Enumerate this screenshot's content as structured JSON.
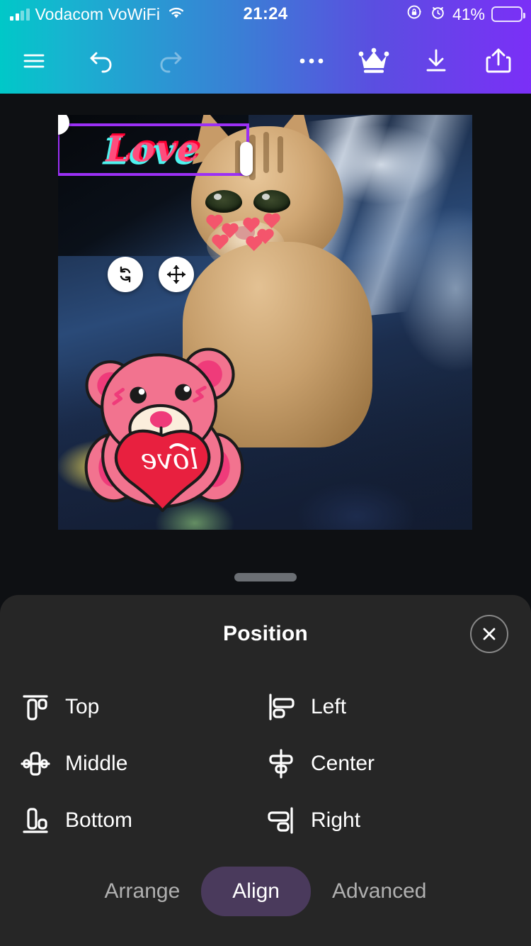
{
  "status_bar": {
    "carrier": "Vodacom VoWiFi",
    "time": "21:24",
    "battery_percent": "41%",
    "icons": [
      "signal-bars-icon",
      "wifi-icon",
      "rotation-lock-icon",
      "alarm-clock-icon",
      "battery-icon"
    ],
    "battery_fill_color": "#ffcc00",
    "battery_level": 41
  },
  "toolbar": {
    "gradient_start": "#00c8c8",
    "gradient_mid": "#3a7fd5",
    "gradient_end": "#7b2ff7",
    "buttons": [
      {
        "name": "menu-button",
        "icon": "hamburger-menu-icon",
        "enabled": true
      },
      {
        "name": "undo-button",
        "icon": "undo-arrow-icon",
        "enabled": true
      },
      {
        "name": "redo-button",
        "icon": "redo-arrow-icon",
        "enabled": false
      },
      {
        "name": "more-options-button",
        "icon": "ellipsis-icon",
        "enabled": true
      },
      {
        "name": "premium-button",
        "icon": "crown-icon",
        "enabled": true
      },
      {
        "name": "download-button",
        "icon": "download-arrow-icon",
        "enabled": true
      },
      {
        "name": "share-button",
        "icon": "share-upload-icon",
        "enabled": true
      }
    ]
  },
  "canvas": {
    "background_color": "#0e1013",
    "photo_description": "orange tabby cat on blue and white bedding",
    "text_layer": {
      "text": "Love",
      "selected": true,
      "selection_color": "#9b30f5",
      "fill_color": "#ff4d7d",
      "shadow_color": "#4ff3ef"
    },
    "sticker_bear": {
      "name": "teddy-bear-sticker",
      "heart_text": "love",
      "bear_color": "#f2738f",
      "heart_color": "#e8203f"
    },
    "floating_buttons": [
      {
        "name": "rotate-button",
        "icon": "rotate-icon"
      },
      {
        "name": "move-button",
        "icon": "move-arrows-icon"
      }
    ]
  },
  "panel": {
    "title": "Position",
    "close_icon": "close-x-icon",
    "drag_handle": "panel-drag-handle",
    "align_options": [
      {
        "label": "Top",
        "icon": "align-top-icon",
        "column": "left"
      },
      {
        "label": "Left",
        "icon": "align-left-icon",
        "column": "right"
      },
      {
        "label": "Middle",
        "icon": "align-middle-icon",
        "column": "left"
      },
      {
        "label": "Center",
        "icon": "align-center-icon",
        "column": "right"
      },
      {
        "label": "Bottom",
        "icon": "align-bottom-icon",
        "column": "left"
      },
      {
        "label": "Right",
        "icon": "align-right-icon",
        "column": "right"
      }
    ],
    "tabs": [
      {
        "label": "Arrange",
        "active": false
      },
      {
        "label": "Align",
        "active": true
      },
      {
        "label": "Advanced",
        "active": false
      }
    ],
    "active_tab_color": "#4a3a5c",
    "background_color": "#262626"
  }
}
